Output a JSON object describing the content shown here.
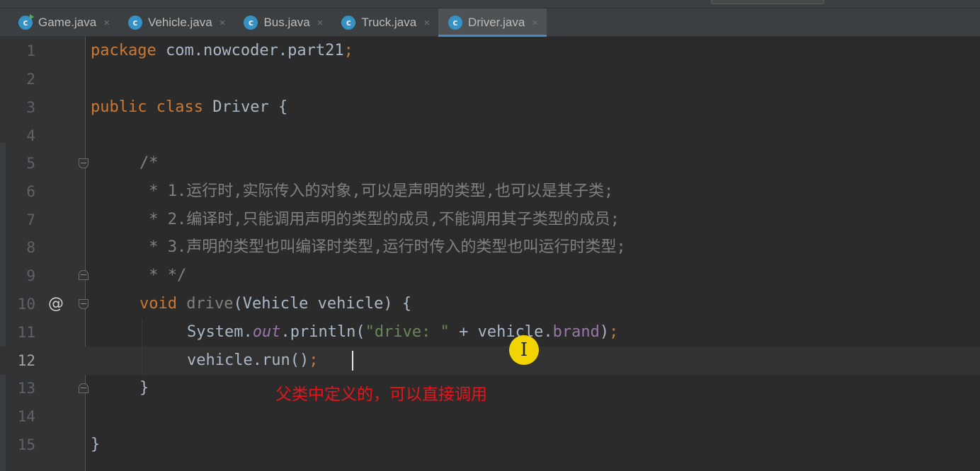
{
  "tabs": [
    {
      "label": "Game.java",
      "icon": "run-class-icon",
      "active": false
    },
    {
      "label": "Vehicle.java",
      "icon": "class-icon",
      "active": false
    },
    {
      "label": "Bus.java",
      "icon": "class-icon",
      "active": false
    },
    {
      "label": "Truck.java",
      "icon": "class-icon",
      "active": false
    },
    {
      "label": "Driver.java",
      "icon": "class-icon",
      "active": true
    }
  ],
  "tab_icon_letter": "c",
  "tab_close_glyph": "×",
  "gutter": {
    "line_numbers": [
      "1",
      "2",
      "3",
      "4",
      "5",
      "6",
      "7",
      "8",
      "9",
      "10",
      "11",
      "12",
      "13",
      "14",
      "15"
    ],
    "override_marker": "@",
    "current_line": "12"
  },
  "code": {
    "line1": {
      "kw": "package",
      "rest": " com.nowcoder.part21",
      "semi": ";"
    },
    "line3": {
      "kw1": "public",
      "kw2": "class",
      "name": "Driver",
      "brace": " {"
    },
    "line5": "/*",
    "line6": " * 1.运行时,实际传入的对象,可以是声明的类型,也可以是其子类;",
    "line7": " * 2.编译时,只能调用声明的类型的成员,不能调用其子类型的成员;",
    "line8": " * 3.声明的类型也叫编译时类型,运行时传入的类型也叫运行时类型;",
    "line9": " * */",
    "line10": {
      "kw": "void",
      "method": "drive",
      "params": "(Vehicle vehicle) {"
    },
    "line11": {
      "sys": "System.",
      "out": "out",
      "call": ".println(",
      "str": "\"drive: \"",
      "plus": " + vehicle.",
      "field": "brand",
      "close": ")",
      "semi": ";"
    },
    "line12": {
      "call": "vehicle.run()",
      "semi": ";"
    },
    "line13": "}",
    "line15": "}"
  },
  "subtitle": "父类中定义的，可以直接调用",
  "colors": {
    "keyword": "#cc7832",
    "comment": "#808080",
    "string": "#6a8759",
    "field": "#9876aa",
    "subtitle": "#e8141b"
  }
}
